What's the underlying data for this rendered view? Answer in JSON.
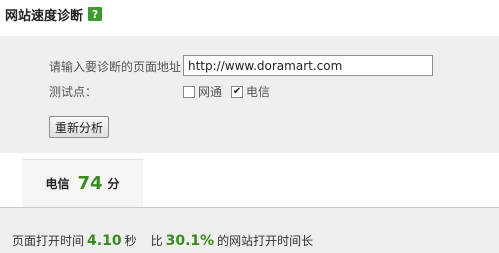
{
  "header": {
    "title": "网站速度诊断",
    "help_icon_text": "?"
  },
  "form": {
    "url_label": "请输入要诊断的页面地址：",
    "url_value": "http://www.doramart.com",
    "test_points_label": "测试点：",
    "test_points": [
      {
        "label": "网通",
        "checked": false
      },
      {
        "label": "电信",
        "checked": true
      }
    ],
    "reanalyze_label": "重新分析"
  },
  "tab": {
    "name": "电信",
    "score": "74",
    "unit": "分"
  },
  "result": {
    "load_time_prefix": "页面打开时间",
    "load_time_value": "4.10",
    "load_time_unit": "秒",
    "compare_prefix": "比",
    "compare_value": "30.1%",
    "compare_suffix": "的网站打开时间长"
  },
  "colors": {
    "accent_green": "#3a8a20",
    "help_icon_bg": "#3f9a2f"
  }
}
